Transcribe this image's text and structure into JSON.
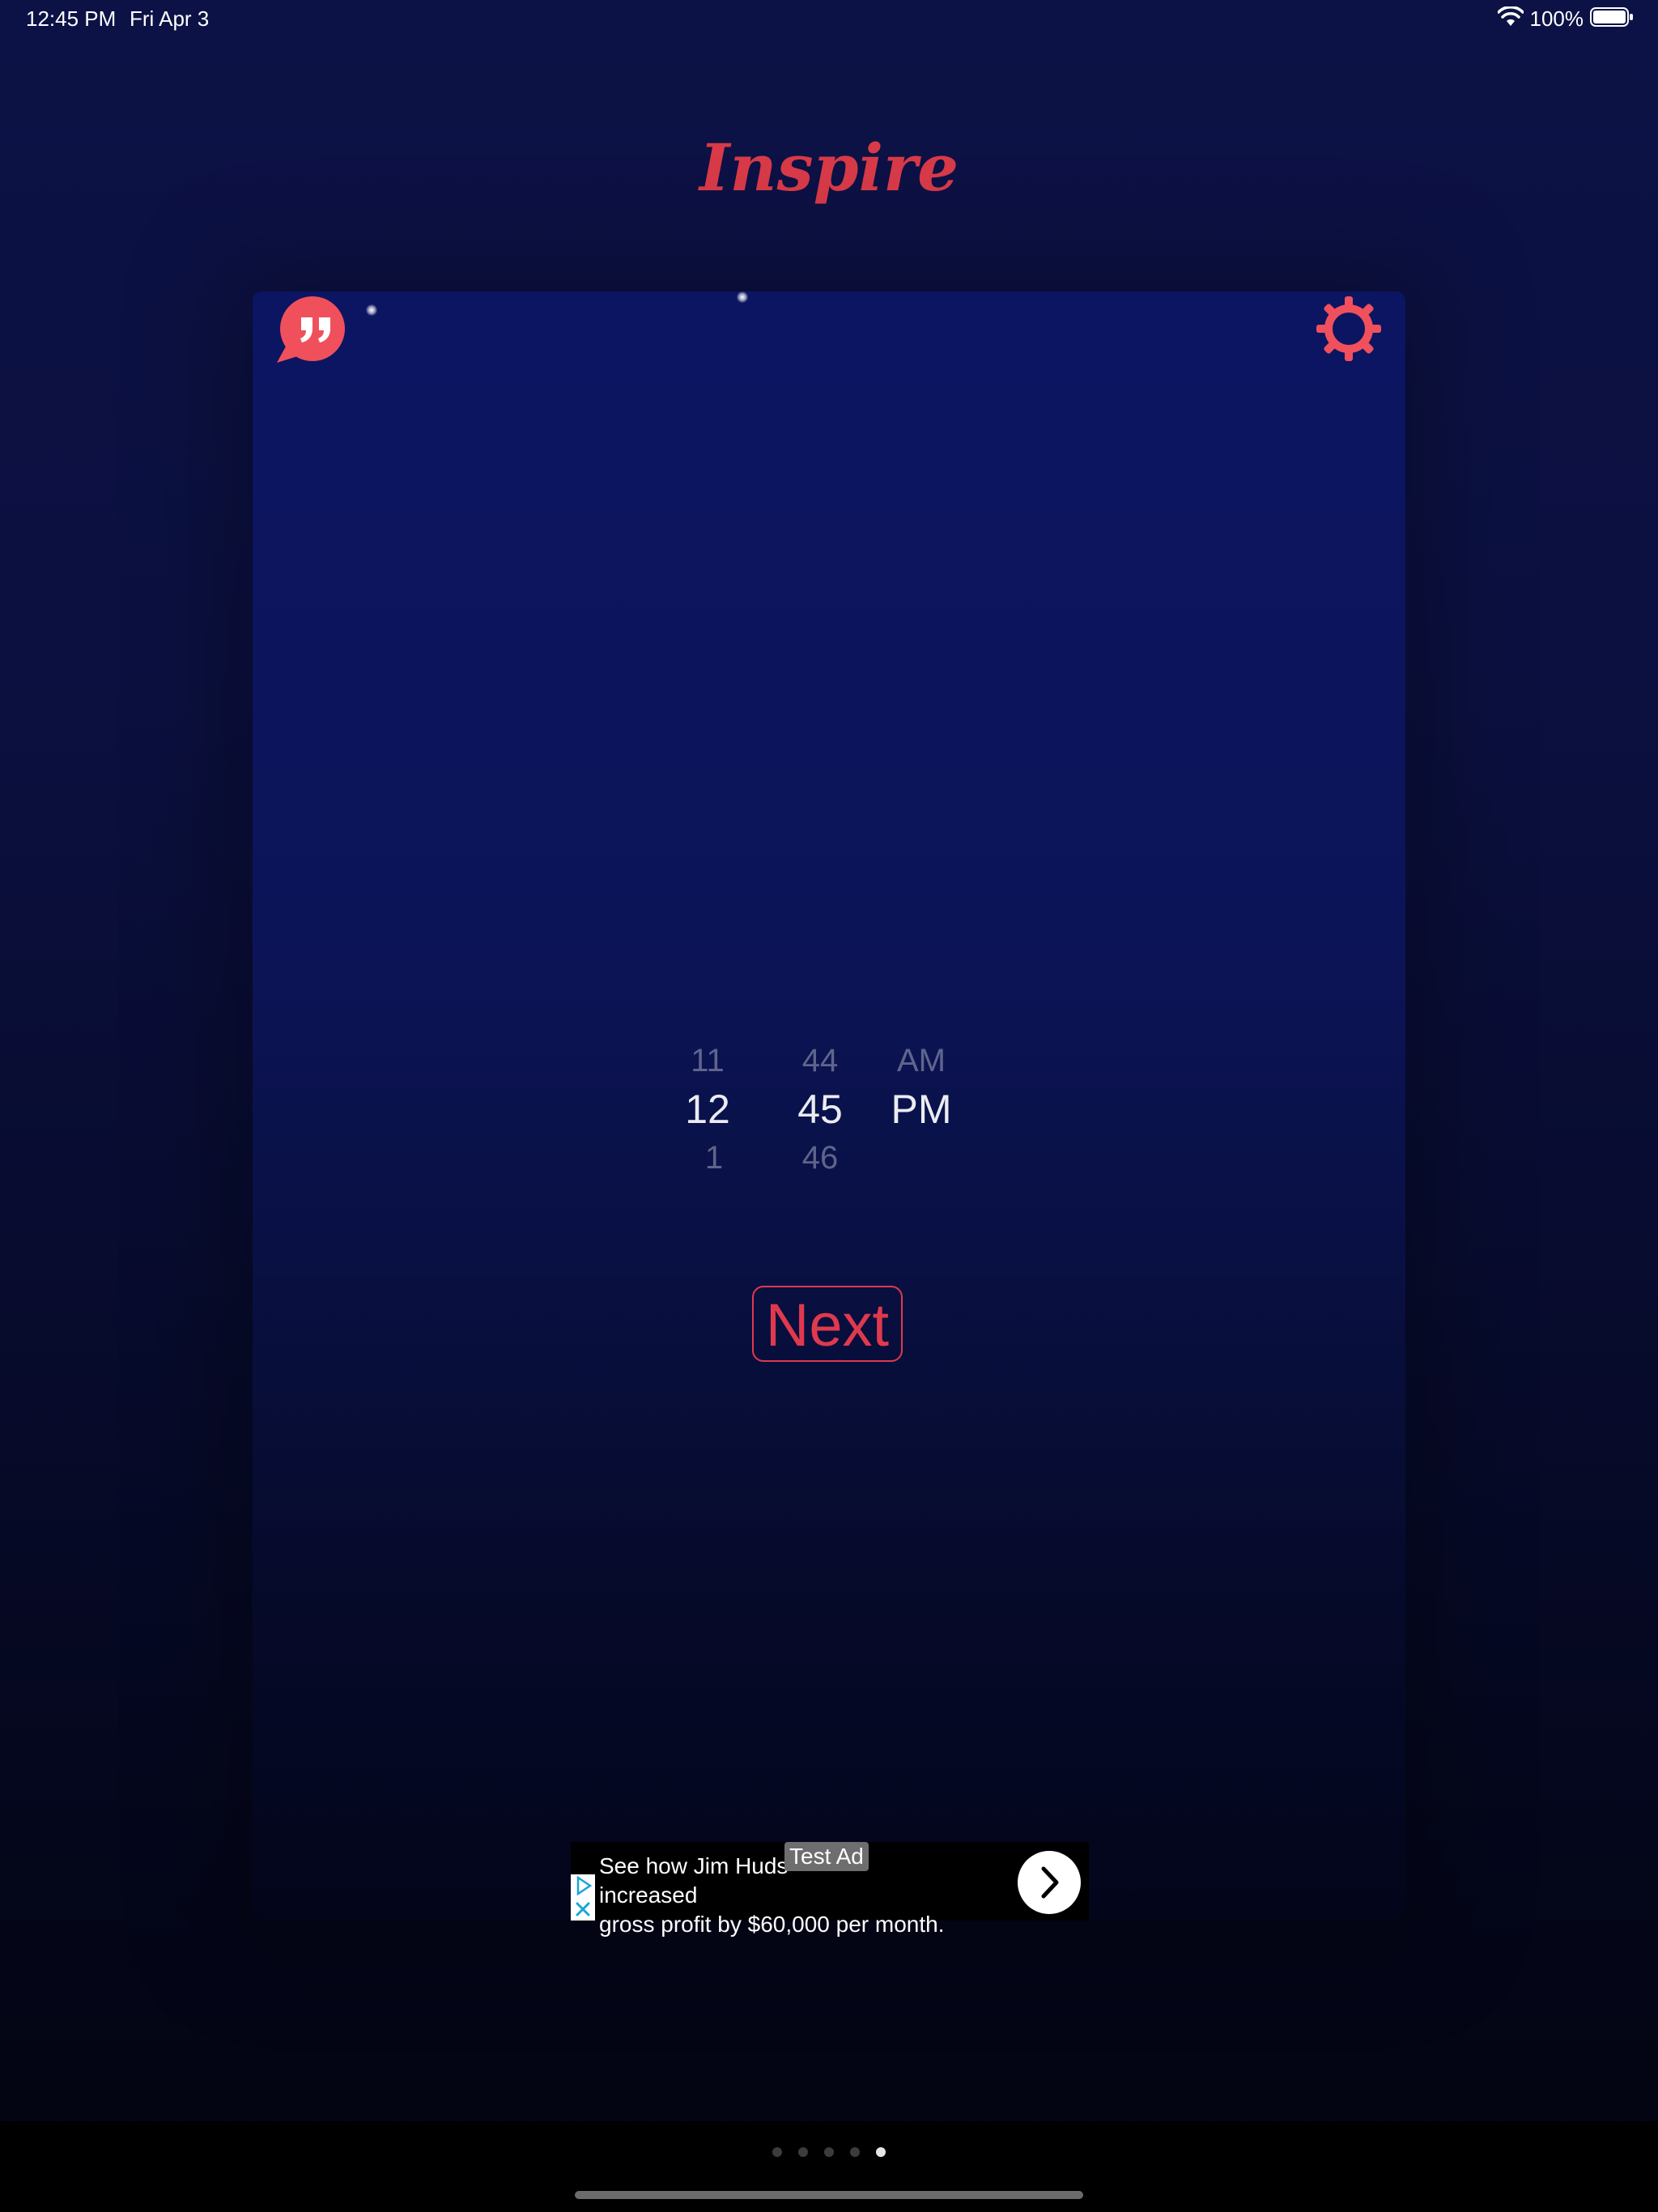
{
  "status_bar": {
    "time": "12:45 PM",
    "date": "Fri Apr 3",
    "battery": "100%",
    "icons": [
      "wifi-icon",
      "battery-icon"
    ]
  },
  "app": {
    "title": "Inspire",
    "accent_color": "#d83a48"
  },
  "toolbar": {
    "quote_icon": "quote-bubble-icon",
    "settings_icon": "gear-icon"
  },
  "time_picker": {
    "hour": {
      "prev": "11",
      "selected": "12",
      "next": "1"
    },
    "minute": {
      "prev": "44",
      "selected": "45",
      "next": "46"
    },
    "period": {
      "prev": "AM",
      "selected": "PM"
    }
  },
  "next_button": {
    "label": "Next"
  },
  "ad": {
    "tag": "Test Ad",
    "line1": "See how Jim Huds",
    "line1_rest": " increased",
    "line2": "gross profit by $60,000 per month.",
    "choices_icon": "ad-choices-icon",
    "arrow_icon": "chevron-right-icon"
  },
  "page_indicator": {
    "count": 5,
    "active_index": 4
  }
}
